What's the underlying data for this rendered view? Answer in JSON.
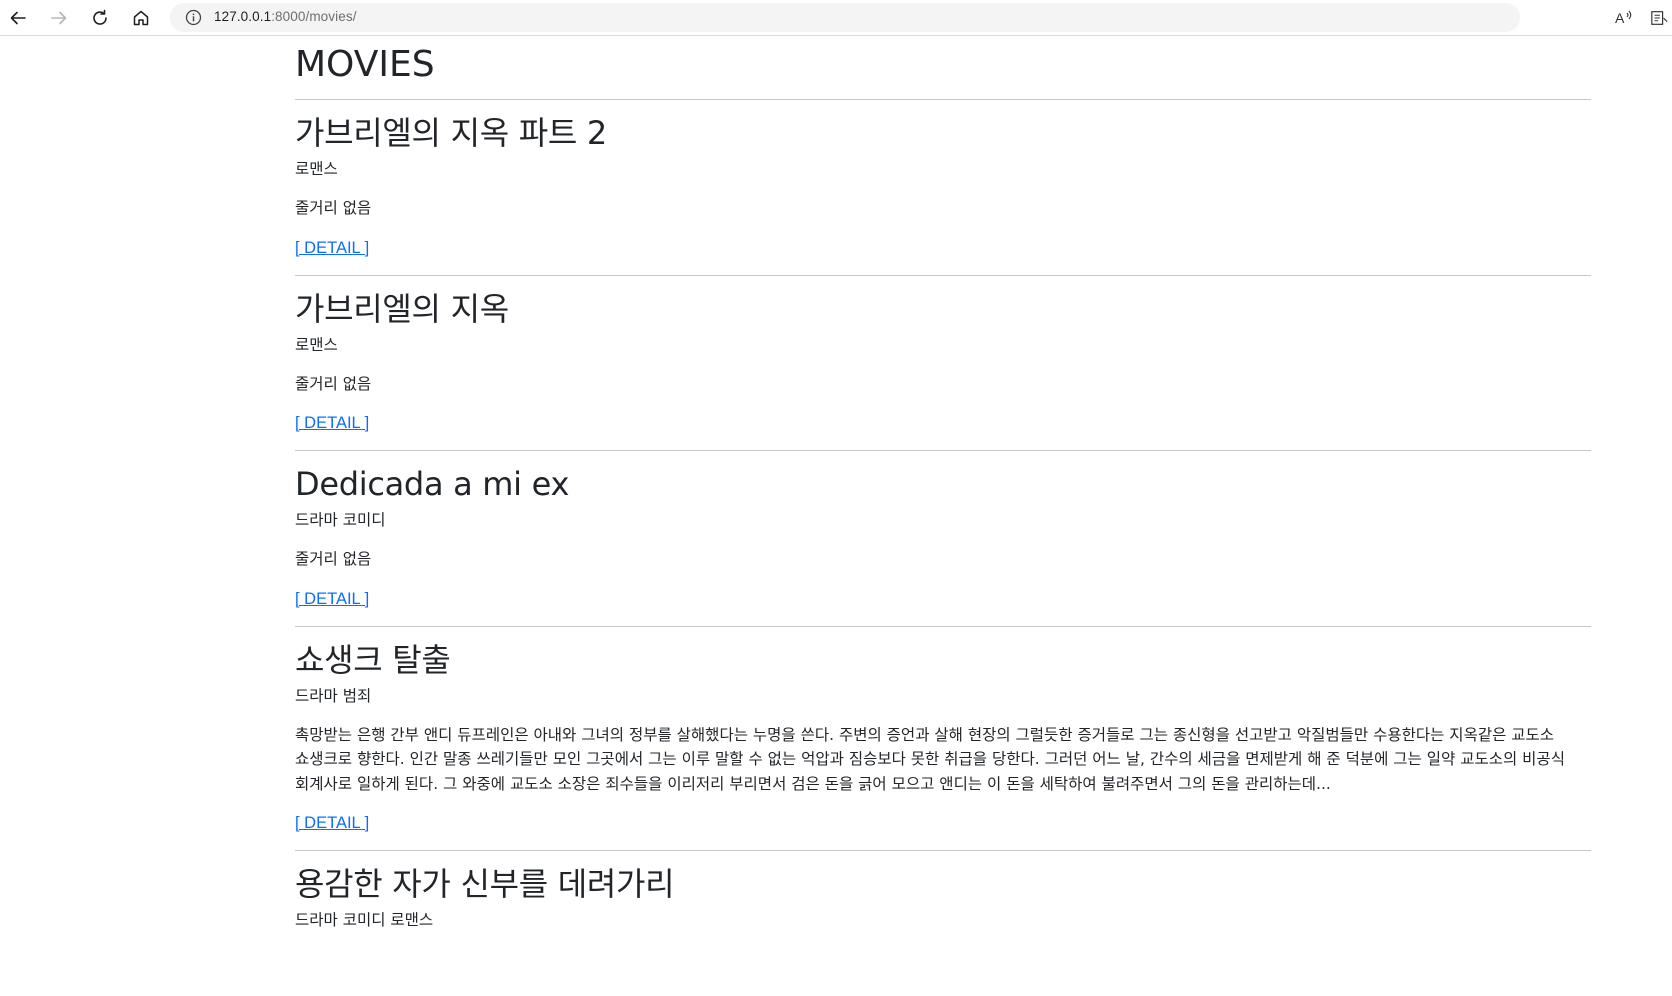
{
  "browser": {
    "url_host": "127.0.0.1",
    "url_rest": ":8000/movies/",
    "icons": [
      "back-arrow-icon",
      "forward-arrow-icon",
      "reload-icon",
      "home-icon",
      "info-icon",
      "read-aloud-icon",
      "immersive-reader-icon"
    ]
  },
  "page": {
    "title": "MOVIES"
  },
  "movies": [
    {
      "title": "가브리엘의 지옥 파트 2",
      "genre": "로맨스",
      "description": "줄거리 없음",
      "link_label": "[ DETAIL ]"
    },
    {
      "title": "가브리엘의 지옥",
      "genre": "로맨스",
      "description": "줄거리 없음",
      "link_label": "[ DETAIL ]"
    },
    {
      "title": "Dedicada a mi ex",
      "genre": "드라마 코미디",
      "description": "줄거리 없음",
      "link_label": "[ DETAIL ]"
    },
    {
      "title": "쇼생크 탈출",
      "genre": "드라마 범죄",
      "description": "촉망받는 은행 간부 앤디 듀프레인은 아내와 그녀의 정부를 살해했다는 누명을 쓴다. 주변의 증언과 살해 현장의 그럴듯한 증거들로 그는 종신형을 선고받고 악질범들만 수용한다는 지옥같은 교도소 쇼생크로 향한다. 인간 말종 쓰레기들만 모인 그곳에서 그는 이루 말할 수 없는 억압과 짐승보다 못한 취급을 당한다. 그러던 어느 날, 간수의 세금을 면제받게 해 준 덕분에 그는 일약 교도소의 비공식 회계사로 일하게 된다. 그 와중에 교도소 소장은 죄수들을 이리저리 부리면서 검은 돈을 긁어 모으고 앤디는 이 돈을 세탁하여 불려주면서 그의 돈을 관리하는데...",
      "link_label": "[ DETAIL ]"
    },
    {
      "title": "용감한 자가 신부를 데려가리",
      "genre": "드라마 코미디 로맨스"
    }
  ],
  "colors": {
    "link": "#0d6efd",
    "text": "#212529",
    "divider": "#c8c8c8"
  }
}
